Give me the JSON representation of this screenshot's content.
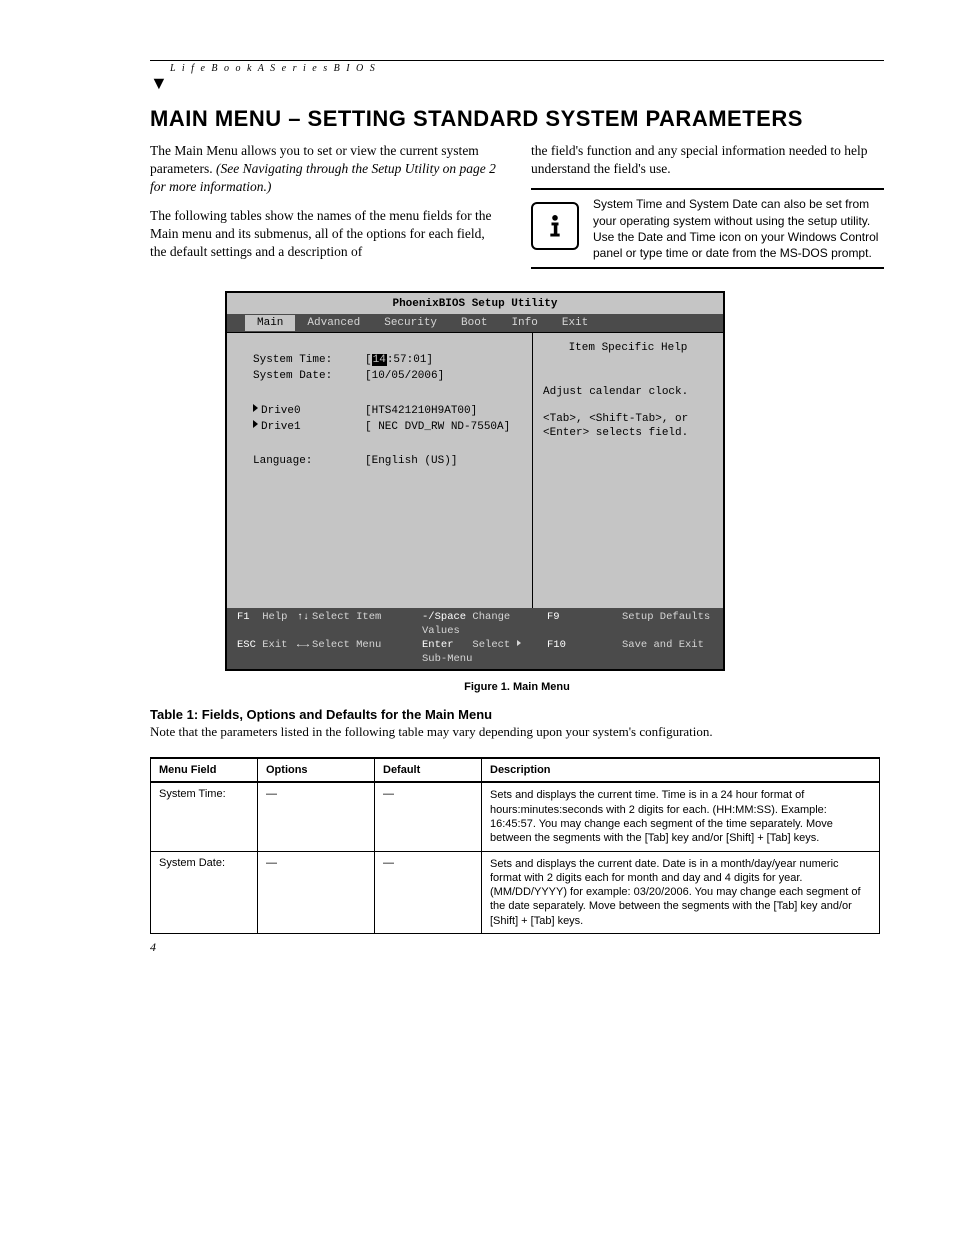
{
  "header": {
    "label": "L i f e B o o k   A   S e r i e s   B I O S"
  },
  "title": "MAIN MENU – SETTING STANDARD SYSTEM PARAMETERS",
  "intro": {
    "p1a": "The Main Menu allows you to set or view the current system parameters. ",
    "p1b": "(See Navigating through the Setup Utility on page 2 for more information.)",
    "p2": "The following tables show the names of the menu fields for the Main menu and its submenus, all of the options for each field, the default settings and a description of",
    "p3": "the field's function and any special information needed to help understand the field's use.",
    "note": "System Time and System Date can also be set from your operating system without using the setup utility. Use the Date and Time icon on your Windows Control panel or type time or date from the MS-DOS prompt."
  },
  "bios": {
    "title": "PhoenixBIOS Setup Utility",
    "tabs": [
      "Main",
      "Advanced",
      "Security",
      "Boot",
      "Info",
      "Exit"
    ],
    "activeTab": "Main",
    "rows": {
      "time_label": "System Time:",
      "time_hl": "14",
      "time_rest": ":57:01]",
      "date_label": "System Date:",
      "date_val": "[10/05/2006]",
      "drive0_label": "Drive0",
      "drive0_val": "[HTS421210H9AT00]",
      "drive1_label": "Drive1",
      "drive1_val": "[ NEC DVD_RW ND-7550A]",
      "lang_label": "Language:",
      "lang_val": "[English (US)]"
    },
    "help": {
      "title": "Item Specific Help",
      "l1": "Adjust calendar clock.",
      "l2": "<Tab>, <Shift-Tab>, or",
      "l3": "<Enter> selects field."
    },
    "footer": {
      "f1": "F1",
      "f1t": "Help",
      "esc": "ESC",
      "esct": "Exit",
      "si": "Select Item",
      "sm": "Select Menu",
      "cv_k": "-/Space",
      "cv": "Change Values",
      "en_k": "Enter",
      "en": "Select    Sub-Menu",
      "f9": "F9",
      "f9t": "Setup Defaults",
      "f10": "F10",
      "f10t": "Save and Exit"
    }
  },
  "figcap": "Figure 1.  Main Menu",
  "table": {
    "title": "Table 1: Fields, Options and Defaults for the Main Menu",
    "note": "Note that the parameters listed in the following table may vary depending upon your system's configuration.",
    "headers": [
      "Menu Field",
      "Options",
      "Default",
      "Description"
    ],
    "rows": [
      {
        "field": "System Time:",
        "options": "—",
        "def": "—",
        "desc": "Sets and displays the current time. Time is in a 24 hour format of hours:minutes:seconds with 2 digits for each. (HH:MM:SS). Example: 16:45:57. You may change each segment of the time separately. Move between the segments with the [Tab] key and/or [Shift] + [Tab] keys."
      },
      {
        "field": "System Date:",
        "options": "—",
        "def": "—",
        "desc": "Sets and displays the current date. Date is in a month/day/year numeric format with 2 digits each for month and day and 4 digits for year. (MM/DD/YYYY) for example: 03/20/2006. You may change each segment of the date separately. Move between the segments with the [Tab] key and/or [Shift] + [Tab] keys."
      }
    ]
  },
  "pageNum": "4"
}
